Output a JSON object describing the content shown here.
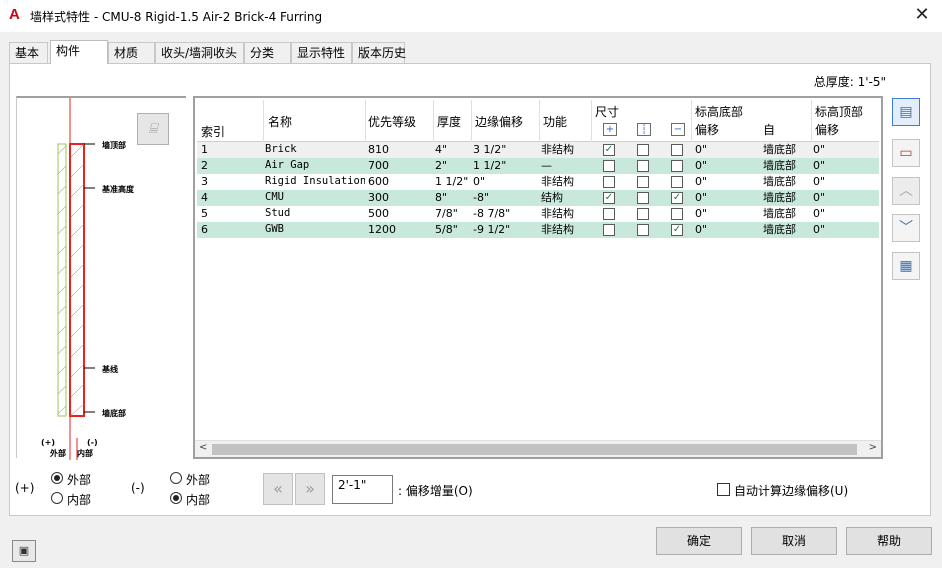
{
  "window": {
    "title": "墙样式特性 - CMU-8 Rigid-1.5 Air-2 Brick-4 Furring",
    "app_icon": "A",
    "close_glyph": "✕"
  },
  "tabs": [
    {
      "label": "基本"
    },
    {
      "label": "构件",
      "active": true
    },
    {
      "label": "材质"
    },
    {
      "label": "收头/墙洞收头"
    },
    {
      "label": "分类"
    },
    {
      "label": "显示特性"
    },
    {
      "label": "版本历史"
    }
  ],
  "total_thickness": "总厚度: 1'-5\"",
  "preview": {
    "labels": [
      "墙顶部",
      "基准高度",
      "基线",
      "墙底部"
    ],
    "exterior_label": "(+)\n外部",
    "interior_label": "(-)\n内部",
    "exterior_sign": "(+)",
    "exterior_text": "外部",
    "interior_sign": "(-)",
    "interior_text": "内部",
    "button_icon": "wall-tool-icon"
  },
  "grid": {
    "columns": {
      "index": "索引",
      "name": "名称",
      "priority": "优先等级",
      "thickness": "厚度",
      "edge_offset": "边缘偏移",
      "function": "功能",
      "dimension": "尺寸",
      "bottom_elev": "标高底部",
      "bottom_offset": "偏移",
      "from": "自",
      "top_elev": "标高顶部",
      "top_offset": "偏移"
    },
    "rows": [
      {
        "index": "1",
        "name": "Brick",
        "priority": "810",
        "thickness": "4\"",
        "edge_offset": "3 1/2\"",
        "function": "非结构",
        "dim1": true,
        "dim2": false,
        "dim3": false,
        "bottom_offset": "0\"",
        "from": "墙底部",
        "top_offset": "0\""
      },
      {
        "index": "2",
        "name": "Air Gap",
        "priority": "700",
        "thickness": "2\"",
        "edge_offset": "1 1/2\"",
        "function": "—",
        "dim1": false,
        "dim2": false,
        "dim3": false,
        "bottom_offset": "0\"",
        "from": "墙底部",
        "top_offset": "0\""
      },
      {
        "index": "3",
        "name": "Rigid Insulation",
        "priority": "600",
        "thickness": "1 1/2\"",
        "edge_offset": "0\"",
        "function": "非结构",
        "dim1": false,
        "dim2": false,
        "dim3": false,
        "bottom_offset": "0\"",
        "from": "墙底部",
        "top_offset": "0\""
      },
      {
        "index": "4",
        "name": "CMU",
        "priority": "300",
        "thickness": "8\"",
        "edge_offset": "-8\"",
        "function": "结构",
        "dim1": true,
        "dim2": false,
        "dim3": true,
        "bottom_offset": "0\"",
        "from": "墙底部",
        "top_offset": "0\""
      },
      {
        "index": "5",
        "name": "Stud",
        "priority": "500",
        "thickness": "7/8\"",
        "edge_offset": "-8 7/8\"",
        "function": "非结构",
        "dim1": false,
        "dim2": false,
        "dim3": false,
        "bottom_offset": "0\"",
        "from": "墙底部",
        "top_offset": "0\""
      },
      {
        "index": "6",
        "name": "GWB",
        "priority": "1200",
        "thickness": "5/8\"",
        "edge_offset": "-9 1/2\"",
        "function": "非结构",
        "dim1": false,
        "dim2": false,
        "dim3": true,
        "bottom_offset": "0\"",
        "from": "墙底部",
        "top_offset": "0\""
      }
    ]
  },
  "side_buttons": [
    "add-component-icon",
    "delete-component-icon",
    "move-up-icon",
    "move-down-icon",
    "properties-icon"
  ],
  "bottom": {
    "plus_label": "(+)",
    "minus_label": "(-)",
    "exterior": "外部",
    "interior": "内部",
    "plus_selected": "exterior",
    "minus_selected": "interior",
    "offset_value": "2'-1\"",
    "offset_label": ": 偏移增量(O)",
    "auto_calc_label": "自动计算边缘偏移(U)",
    "auto_calc_checked": false
  },
  "buttons": {
    "ok": "确定",
    "cancel": "取消",
    "help": "帮助"
  },
  "colors": {
    "alt_row": "#c9e8dc",
    "wall_red": "#e8231f",
    "wall_green": "#9bc45a",
    "check_green": "#1b7a3c"
  }
}
